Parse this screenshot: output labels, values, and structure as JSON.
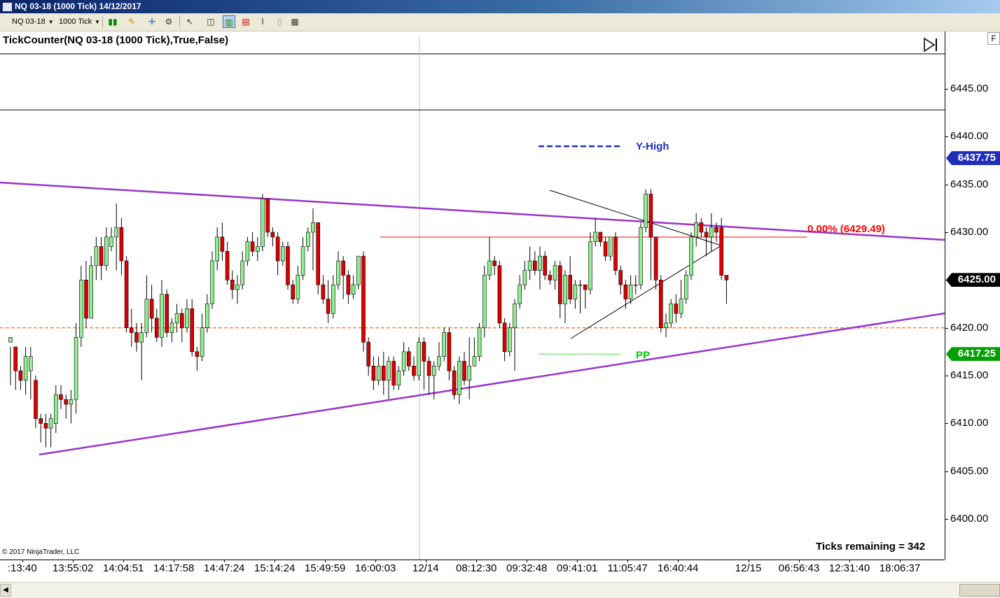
{
  "window": {
    "title": "NQ 03-18 (1000 Tick)  14/12/2017"
  },
  "toolbar": {
    "instrument": "NQ 03-18",
    "interval": "1000 Tick",
    "icons": [
      "bar-style-icon",
      "draw-pencil-icon",
      "crosshair-icon",
      "settings-icon",
      "pointer-icon",
      "zoom-icon",
      "chart-bars-icon",
      "chart-candles-icon",
      "line-chart-icon",
      "data-box-icon",
      "properties-icon"
    ]
  },
  "panel": {
    "indicator_label": "TickCounter(NQ 03-18 (1000 Tick),True,False)",
    "ticks_remaining": "Ticks remaining = 342",
    "copyright": "© 2017 NinjaTrader, LLC",
    "f_button": "F"
  },
  "y_axis": {
    "ticks": [
      "6445.00",
      "6440.00",
      "6435.00",
      "6430.00",
      "6425.00",
      "6420.00",
      "6415.00",
      "6410.00",
      "6405.00",
      "6400.00"
    ],
    "tick_values": [
      6445,
      6440,
      6435,
      6430,
      6425,
      6420,
      6415,
      6410,
      6405,
      6400
    ],
    "flags": [
      {
        "text": "6437.75",
        "value": 6437.75,
        "color": "#1f2dbd"
      },
      {
        "text": "6425.00",
        "value": 6425.0,
        "color": "#000000"
      },
      {
        "text": "6417.25",
        "value": 6417.25,
        "color": "#00a000"
      }
    ]
  },
  "x_axis": {
    "labels": [
      ":13:40",
      "13:55:02",
      "14:04:51",
      "14:17:58",
      "14:47:24",
      "15:14:24",
      "15:49:59",
      "16:00:03",
      "12/14",
      "08:12:30",
      "09:32:48",
      "09:41:01",
      "11:05:47",
      "16:40:44",
      "12/15",
      "06:56:43",
      "12:31:40",
      "18:06:37"
    ],
    "label_bars": [
      0,
      10,
      20,
      30,
      40,
      50,
      60,
      70,
      80,
      90,
      100,
      110,
      120,
      130,
      144,
      154,
      164,
      174
    ]
  },
  "annotations": {
    "y_high": {
      "text": "Y-High",
      "value": 6437.75,
      "color": "#1f2dbd"
    },
    "pp": {
      "text": "PP",
      "value": 6417.25,
      "color": "#00cc00"
    },
    "fib": {
      "text": "0.00% (6429.49)",
      "value": 6429.49,
      "color": "#ff0000"
    },
    "orange_level": {
      "value": 6420.0,
      "color": "#ff7f27"
    },
    "black_level": {
      "value": 6442.8,
      "color": "#000000"
    },
    "trendline_color": "#9933cc"
  },
  "chart_data": {
    "type": "candlestick",
    "title": "",
    "ylim": [
      6398,
      6450
    ],
    "up_color": "#90ee90",
    "down_color": "#dd0000",
    "candles": [
      [
        6418.5,
        6419.0,
        6414.0,
        6418.0
      ],
      [
        6418.0,
        6415.5,
        6413.5,
        6416.0
      ],
      [
        6415.5,
        6414.5,
        6413.5,
        6416.0
      ],
      [
        6414.5,
        6417.0,
        6413.0,
        6418.0
      ],
      [
        6415.5,
        6417.0,
        6412.5,
        6418.0
      ],
      [
        6414.5,
        6410.5,
        6409.5,
        6415.0
      ],
      [
        6410.5,
        6410.0,
        6408.0,
        6411.0
      ],
      [
        6410.0,
        6409.5,
        6407.5,
        6411.0
      ],
      [
        6409.5,
        6410.5,
        6407.5,
        6411.0
      ],
      [
        6410.0,
        6413.0,
        6409.0,
        6414.0
      ],
      [
        6413.0,
        6412.5,
        6411.5,
        6414.0
      ],
      [
        6412.5,
        6412.0,
        6410.5,
        6413.0
      ],
      [
        6412.0,
        6412.5,
        6410.0,
        6413.5
      ],
      [
        6412.5,
        6419.0,
        6411.0,
        6420.5
      ],
      [
        6419.0,
        6425.0,
        6418.0,
        6426.5
      ],
      [
        6425.0,
        6421.0,
        6420.0,
        6427.0
      ],
      [
        6421.0,
        6426.5,
        6421.0,
        6427.5
      ],
      [
        6426.5,
        6428.5,
        6425.0,
        6429.5
      ],
      [
        6428.5,
        6426.5,
        6425.0,
        6429.5
      ],
      [
        6426.5,
        6429.5,
        6426.0,
        6430.5
      ],
      [
        6428.5,
        6429.5,
        6428.0,
        6430.5
      ],
      [
        6429.5,
        6430.5,
        6426.0,
        6433.0
      ],
      [
        6430.5,
        6427.0,
        6425.5,
        6431.5
      ],
      [
        6427.0,
        6420.0,
        6419.5,
        6427.5
      ],
      [
        6420.0,
        6419.5,
        6418.0,
        6422.0
      ],
      [
        6419.5,
        6418.5,
        6417.5,
        6420.5
      ],
      [
        6418.5,
        6419.5,
        6414.5,
        6420.5
      ],
      [
        6419.5,
        6423.0,
        6419.0,
        6425.5
      ],
      [
        6423.0,
        6421.0,
        6419.5,
        6424.5
      ],
      [
        6421.0,
        6419.0,
        6418.5,
        6422.0
      ],
      [
        6419.0,
        6423.5,
        6418.0,
        6425.0
      ],
      [
        6423.5,
        6419.5,
        6419.0,
        6424.0
      ],
      [
        6419.5,
        6420.5,
        6418.5,
        6421.0
      ],
      [
        6420.5,
        6421.5,
        6419.5,
        6422.5
      ],
      [
        6421.5,
        6420.0,
        6418.5,
        6422.0
      ],
      [
        6420.0,
        6422.0,
        6419.5,
        6423.0
      ],
      [
        6422.0,
        6417.5,
        6417.0,
        6423.0
      ],
      [
        6417.5,
        6417.0,
        6415.5,
        6418.0
      ],
      [
        6417.0,
        6420.0,
        6416.5,
        6421.5
      ],
      [
        6420.0,
        6422.5,
        6419.5,
        6423.5
      ],
      [
        6422.5,
        6427.0,
        6422.0,
        6428.0
      ],
      [
        6427.0,
        6429.5,
        6426.0,
        6430.5
      ],
      [
        6429.5,
        6428.0,
        6427.0,
        6431.0
      ],
      [
        6428.0,
        6425.0,
        6424.5,
        6429.0
      ],
      [
        6425.0,
        6424.0,
        6423.0,
        6426.0
      ],
      [
        6424.0,
        6424.5,
        6422.5,
        6425.5
      ],
      [
        6424.5,
        6427.0,
        6424.0,
        6428.0
      ],
      [
        6427.0,
        6429.0,
        6426.5,
        6429.5
      ],
      [
        6429.0,
        6428.0,
        6427.5,
        6430.0
      ],
      [
        6428.0,
        6428.5,
        6427.0,
        6429.5
      ],
      [
        6428.5,
        6433.5,
        6428.0,
        6434.0
      ],
      [
        6433.5,
        6430.0,
        6429.5,
        6433.5
      ],
      [
        6430.0,
        6429.5,
        6428.5,
        6430.5
      ],
      [
        6429.5,
        6427.0,
        6425.5,
        6430.0
      ],
      [
        6427.0,
        6428.5,
        6426.5,
        6429.0
      ],
      [
        6428.5,
        6424.5,
        6424.0,
        6429.0
      ],
      [
        6424.5,
        6423.0,
        6422.5,
        6425.0
      ],
      [
        6423.0,
        6425.5,
        6422.5,
        6426.5
      ],
      [
        6425.5,
        6428.5,
        6425.0,
        6429.5
      ],
      [
        6428.5,
        6430.0,
        6428.0,
        6430.5
      ],
      [
        6430.0,
        6431.0,
        6426.0,
        6432.5
      ],
      [
        6431.0,
        6424.5,
        6423.5,
        6431.0
      ],
      [
        6424.5,
        6423.0,
        6422.5,
        6425.5
      ],
      [
        6423.0,
        6421.5,
        6420.5,
        6425.0
      ],
      [
        6421.5,
        6424.5,
        6421.0,
        6425.5
      ],
      [
        6424.5,
        6427.0,
        6424.0,
        6428.0
      ],
      [
        6427.0,
        6425.5,
        6423.0,
        6427.5
      ],
      [
        6425.5,
        6423.5,
        6422.5,
        6426.0
      ],
      [
        6423.5,
        6424.5,
        6423.0,
        6425.5
      ],
      [
        6424.5,
        6427.5,
        6424.0,
        6427.5
      ],
      [
        6427.5,
        6418.5,
        6417.5,
        6428.0
      ],
      [
        6418.5,
        6416.0,
        6415.0,
        6419.0
      ],
      [
        6416.0,
        6414.5,
        6413.5,
        6417.0
      ],
      [
        6414.5,
        6416.0,
        6414.0,
        6417.0
      ],
      [
        6416.0,
        6414.5,
        6413.0,
        6417.5
      ],
      [
        6414.5,
        6416.5,
        6412.5,
        6417.0
      ],
      [
        6416.5,
        6414.0,
        6413.5,
        6417.0
      ],
      [
        6414.0,
        6415.5,
        6413.5,
        6416.0
      ],
      [
        6415.5,
        6417.5,
        6415.0,
        6418.5
      ],
      [
        6417.5,
        6416.0,
        6415.5,
        6418.0
      ],
      [
        6416.0,
        6415.0,
        6414.5,
        6417.0
      ],
      [
        6415.0,
        6418.5,
        6414.5,
        6419.0
      ],
      [
        6418.5,
        6416.5,
        6413.5,
        6419.0
      ],
      [
        6416.5,
        6415.0,
        6413.0,
        6417.0
      ],
      [
        6415.0,
        6416.0,
        6412.5,
        6416.5
      ],
      [
        6416.0,
        6417.0,
        6415.5,
        6418.5
      ],
      [
        6417.0,
        6419.5,
        6416.5,
        6420.0
      ],
      [
        6419.5,
        6415.5,
        6414.5,
        6420.0
      ],
      [
        6415.5,
        6413.0,
        6412.5,
        6416.0
      ],
      [
        6413.0,
        6416.5,
        6412.0,
        6417.0
      ],
      [
        6416.5,
        6414.5,
        6414.0,
        6417.5
      ],
      [
        6414.5,
        6416.0,
        6412.5,
        6419.0
      ],
      [
        6416.0,
        6417.0,
        6416.0,
        6419.0
      ],
      [
        6417.0,
        6420.0,
        6416.5,
        6420.5
      ],
      [
        6420.0,
        6425.5,
        6419.0,
        6426.5
      ],
      [
        6425.5,
        6427.0,
        6425.0,
        6429.5
      ],
      [
        6427.0,
        6426.5,
        6425.5,
        6427.5
      ],
      [
        6426.5,
        6420.5,
        6420.0,
        6427.0
      ],
      [
        6420.5,
        6417.5,
        6416.5,
        6421.0
      ],
      [
        6417.5,
        6420.0,
        6417.0,
        6420.5
      ],
      [
        6420.0,
        6422.5,
        6415.5,
        6423.0
      ],
      [
        6422.5,
        6424.5,
        6422.0,
        6425.5
      ],
      [
        6424.5,
        6426.0,
        6424.0,
        6427.0
      ],
      [
        6426.0,
        6427.0,
        6425.0,
        6428.5
      ],
      [
        6427.0,
        6426.0,
        6425.5,
        6428.0
      ],
      [
        6426.0,
        6427.5,
        6424.0,
        6428.5
      ],
      [
        6427.5,
        6425.5,
        6425.0,
        6428.0
      ],
      [
        6425.5,
        6425.0,
        6424.5,
        6426.0
      ],
      [
        6425.0,
        6426.5,
        6424.0,
        6427.0
      ],
      [
        6426.5,
        6422.5,
        6421.0,
        6427.0
      ],
      [
        6422.5,
        6425.5,
        6420.5,
        6426.0
      ],
      [
        6425.5,
        6423.0,
        6422.5,
        6427.5
      ],
      [
        6423.0,
        6424.5,
        6422.0,
        6425.0
      ],
      [
        6424.5,
        6424.5,
        6421.5,
        6425.0
      ],
      [
        6424.5,
        6424.0,
        6422.0,
        6424.5
      ],
      [
        6424.0,
        6429.0,
        6423.5,
        6430.0
      ],
      [
        6429.0,
        6430.0,
        6428.5,
        6431.5
      ],
      [
        6430.0,
        6429.0,
        6428.5,
        6430.0
      ],
      [
        6429.0,
        6427.5,
        6427.0,
        6429.5
      ],
      [
        6427.5,
        6429.5,
        6427.0,
        6429.5
      ],
      [
        6429.5,
        6426.0,
        6425.5,
        6430.0
      ],
      [
        6426.0,
        6424.5,
        6423.5,
        6426.5
      ],
      [
        6424.5,
        6423.0,
        6422.0,
        6425.0
      ],
      [
        6423.0,
        6424.5,
        6422.5,
        6425.5
      ],
      [
        6424.5,
        6424.5,
        6423.5,
        6425.5
      ],
      [
        6424.5,
        6430.5,
        6424.0,
        6431.0
      ],
      [
        6430.5,
        6434.0,
        6430.0,
        6434.5
      ],
      [
        6434.0,
        6429.5,
        6425.0,
        6434.5
      ],
      [
        6429.5,
        6425.0,
        6424.0,
        6429.5
      ],
      [
        6425.0,
        6420.0,
        6419.5,
        6425.5
      ],
      [
        6420.0,
        6420.5,
        6419.0,
        6421.5
      ],
      [
        6420.5,
        6422.5,
        6420.0,
        6423.0
      ],
      [
        6422.5,
        6421.5,
        6420.5,
        6423.5
      ],
      [
        6421.5,
        6423.0,
        6421.0,
        6425.0
      ],
      [
        6423.0,
        6425.5,
        6422.5,
        6426.0
      ],
      [
        6425.5,
        6429.5,
        6425.0,
        6430.0
      ],
      [
        6429.5,
        6431.0,
        6428.5,
        6432.0
      ],
      [
        6431.0,
        6430.0,
        6429.5,
        6431.5
      ],
      [
        6430.0,
        6429.5,
        6427.5,
        6430.5
      ],
      [
        6429.5,
        6430.5,
        6428.0,
        6432.0
      ],
      [
        6430.5,
        6430.0,
        6429.0,
        6431.0
      ],
      [
        6430.5,
        6425.5,
        6425.0,
        6431.5
      ],
      [
        6425.5,
        6425.0,
        6422.5,
        6425.5
      ]
    ]
  }
}
